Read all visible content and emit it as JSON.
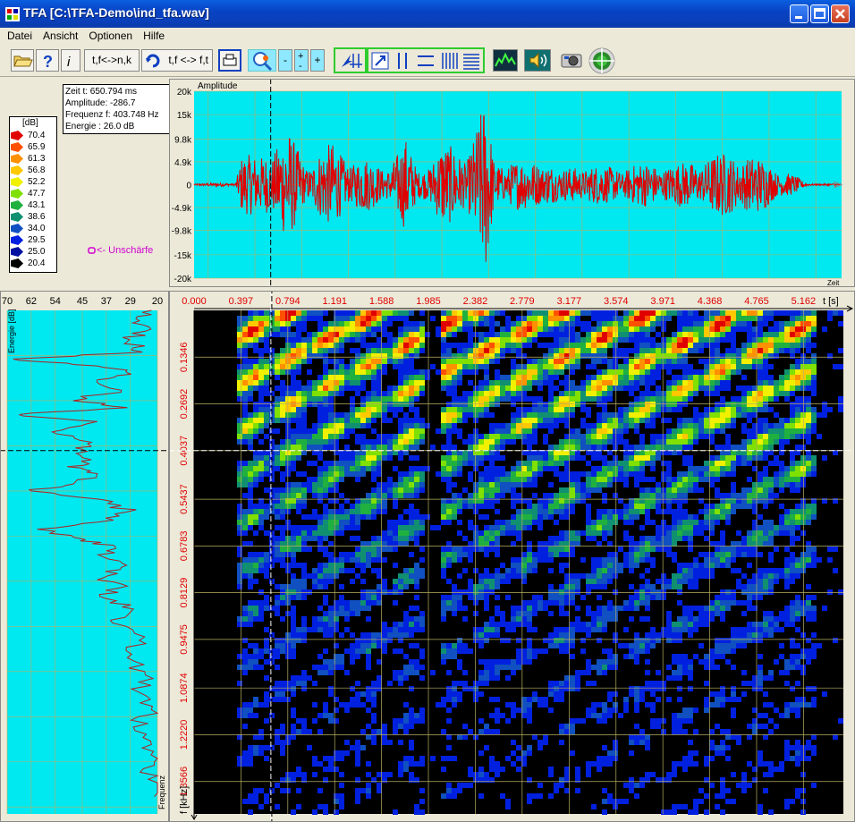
{
  "window": {
    "title": "TFA [C:\\TFA-Demo\\ind_tfa.wav]",
    "controls": [
      "minimize",
      "maximize",
      "close"
    ]
  },
  "menu": [
    {
      "label": "Datei"
    },
    {
      "label": "Ansicht"
    },
    {
      "label": "Optionen"
    },
    {
      "label": "Hilfe"
    }
  ],
  "toolbar": {
    "swap_tfnk_label": "t,f<->n,k",
    "swap_tfft_label": "t,f <-> f,t",
    "zoom_minus_label": "-",
    "zoom_plus_label": "+"
  },
  "info": {
    "time": "Zeit t: 650.794 ms",
    "amplitude": "Amplitude: -286.7",
    "frequency": "Frequenz f: 403.748 Hz",
    "energy": "Energie : 26.0 dB"
  },
  "legend": {
    "unit": "[dB]",
    "items": [
      {
        "value": "70.4",
        "color": "#e00000"
      },
      {
        "value": "65.9",
        "color": "#ff5000"
      },
      {
        "value": "61.3",
        "color": "#ff9000"
      },
      {
        "value": "56.8",
        "color": "#ffc800"
      },
      {
        "value": "52.2",
        "color": "#f0f000"
      },
      {
        "value": "47.7",
        "color": "#80e000"
      },
      {
        "value": "43.1",
        "color": "#20b040"
      },
      {
        "value": "38.6",
        "color": "#109070"
      },
      {
        "value": "34.0",
        "color": "#1050c0"
      },
      {
        "value": "29.5",
        "color": "#0020e0"
      },
      {
        "value": "25.0",
        "color": "#0010a0"
      },
      {
        "value": "20.4",
        "color": "#000000"
      }
    ]
  },
  "blur_label": "<- Unschärfe",
  "waveform": {
    "title": "Amplitude",
    "x_label": "Zeit",
    "y_ticks": [
      "20k",
      "15k",
      "9.8k",
      "4.9k",
      "0",
      "-4.9k",
      "-9.8k",
      "-15k",
      "-20k"
    ],
    "background": "#00e8f0",
    "signal_color": "#e00000"
  },
  "energy_panel": {
    "title": "Energie [dB]",
    "freq_label": "Frequenz",
    "x_ticks": [
      "70",
      "62",
      "54",
      "45",
      "37",
      "29",
      "20"
    ],
    "line_color": "#b02020"
  },
  "spectrogram": {
    "time_ticks": [
      "0.000",
      "0.397",
      "0.794",
      "1.191",
      "1.588",
      "1.985",
      "2.382",
      "2.779",
      "3.177",
      "3.574",
      "3.971",
      "4.368",
      "4.765",
      "5.162"
    ],
    "time_unit": "t [s]",
    "freq_ticks": [
      "0.1346",
      "0.2692",
      "0.4037",
      "0.5437",
      "0.6783",
      "0.8129",
      "0.9475",
      "1.0874",
      "1.2220",
      "1.3566"
    ],
    "freq_unit": "f [kHz]",
    "tick_color": "#e00000"
  },
  "chart_data": [
    {
      "type": "line",
      "title": "Amplitude",
      "xlabel": "Zeit",
      "ylabel": "",
      "ylim": [
        -20000,
        20000
      ],
      "y_ticks": [
        20000,
        15000,
        9800,
        4900,
        0,
        -4900,
        -9800,
        -15000,
        -20000
      ],
      "x_range_s": [
        0,
        5.5
      ],
      "envelope": [
        {
          "t": 0.0,
          "peak": 300
        },
        {
          "t": 0.35,
          "peak": 400
        },
        {
          "t": 0.4,
          "peak": 7000
        },
        {
          "t": 0.55,
          "peak": 6000
        },
        {
          "t": 0.7,
          "peak": 11000
        },
        {
          "t": 0.8,
          "peak": 12000
        },
        {
          "t": 0.95,
          "peak": 4500
        },
        {
          "t": 1.05,
          "peak": 8000
        },
        {
          "t": 1.18,
          "peak": 9000
        },
        {
          "t": 1.3,
          "peak": 6500
        },
        {
          "t": 1.45,
          "peak": 6000
        },
        {
          "t": 1.6,
          "peak": 4000
        },
        {
          "t": 1.8,
          "peak": 10000
        },
        {
          "t": 1.9,
          "peak": 3000
        },
        {
          "t": 2.1,
          "peak": 9000
        },
        {
          "t": 2.3,
          "peak": 7500
        },
        {
          "t": 2.48,
          "peak": 19000
        },
        {
          "t": 2.55,
          "peak": 5000
        },
        {
          "t": 2.7,
          "peak": 6000
        },
        {
          "t": 2.85,
          "peak": 5000
        },
        {
          "t": 3.0,
          "peak": 6500
        },
        {
          "t": 3.1,
          "peak": 3000
        },
        {
          "t": 3.3,
          "peak": 5000
        },
        {
          "t": 3.5,
          "peak": 4000
        },
        {
          "t": 3.7,
          "peak": 4500
        },
        {
          "t": 3.9,
          "peak": 5000
        },
        {
          "t": 4.1,
          "peak": 4500
        },
        {
          "t": 4.3,
          "peak": 6000
        },
        {
          "t": 4.6,
          "peak": 7500
        },
        {
          "t": 4.85,
          "peak": 5500
        },
        {
          "t": 5.1,
          "peak": 2000
        },
        {
          "t": 5.2,
          "peak": 300
        },
        {
          "t": 5.5,
          "peak": 200
        }
      ]
    },
    {
      "type": "line",
      "title": "Energie [dB]",
      "xlabel": "",
      "ylabel": "Frequenz",
      "xlim": [
        70,
        20
      ],
      "x_ticks": [
        70,
        62,
        54,
        45,
        37,
        29,
        20
      ],
      "freq_range_khz": [
        0,
        1.45
      ],
      "points": [
        {
          "f": 0.0,
          "e": 22
        },
        {
          "f": 0.03,
          "e": 26
        },
        {
          "f": 0.06,
          "e": 24
        },
        {
          "f": 0.09,
          "e": 30
        },
        {
          "f": 0.12,
          "e": 25
        },
        {
          "f": 0.14,
          "e": 68
        },
        {
          "f": 0.16,
          "e": 40
        },
        {
          "f": 0.18,
          "e": 30
        },
        {
          "f": 0.2,
          "e": 40
        },
        {
          "f": 0.23,
          "e": 32
        },
        {
          "f": 0.26,
          "e": 48
        },
        {
          "f": 0.28,
          "e": 30
        },
        {
          "f": 0.3,
          "e": 66
        },
        {
          "f": 0.32,
          "e": 40
        },
        {
          "f": 0.35,
          "e": 55
        },
        {
          "f": 0.38,
          "e": 42
        },
        {
          "f": 0.4,
          "e": 45
        },
        {
          "f": 0.43,
          "e": 42
        },
        {
          "f": 0.45,
          "e": 50
        },
        {
          "f": 0.47,
          "e": 40
        },
        {
          "f": 0.5,
          "e": 48
        },
        {
          "f": 0.52,
          "e": 62
        },
        {
          "f": 0.55,
          "e": 35
        },
        {
          "f": 0.58,
          "e": 30
        },
        {
          "f": 0.61,
          "e": 40
        },
        {
          "f": 0.63,
          "e": 60
        },
        {
          "f": 0.66,
          "e": 44
        },
        {
          "f": 0.68,
          "e": 34
        },
        {
          "f": 0.71,
          "e": 38
        },
        {
          "f": 0.74,
          "e": 32
        },
        {
          "f": 0.77,
          "e": 38
        },
        {
          "f": 0.8,
          "e": 33
        },
        {
          "f": 0.83,
          "e": 37
        },
        {
          "f": 0.86,
          "e": 28
        },
        {
          "f": 0.9,
          "e": 35
        },
        {
          "f": 0.95,
          "e": 26
        },
        {
          "f": 1.0,
          "e": 30
        },
        {
          "f": 1.05,
          "e": 24
        },
        {
          "f": 1.1,
          "e": 26
        },
        {
          "f": 1.15,
          "e": 22
        },
        {
          "f": 1.2,
          "e": 28
        },
        {
          "f": 1.25,
          "e": 22
        },
        {
          "f": 1.3,
          "e": 21
        },
        {
          "f": 1.35,
          "e": 23
        },
        {
          "f": 1.4,
          "e": 21
        }
      ]
    },
    {
      "type": "heatmap",
      "title": "",
      "xlabel": "t [s]",
      "ylabel": "f [kHz]",
      "x_ticks": [
        0.0,
        0.397,
        0.794,
        1.191,
        1.588,
        1.985,
        2.382,
        2.779,
        3.177,
        3.574,
        3.971,
        4.368,
        4.765,
        5.162
      ],
      "y_ticks": [
        0.1346,
        0.2692,
        0.4037,
        0.5437,
        0.6783,
        0.8129,
        0.9475,
        1.0874,
        1.222,
        1.3566
      ],
      "colorscale_db": [
        20.4,
        70.4
      ],
      "cursor": {
        "t_ms": 650.794,
        "f_hz": 403.748
      }
    }
  ]
}
